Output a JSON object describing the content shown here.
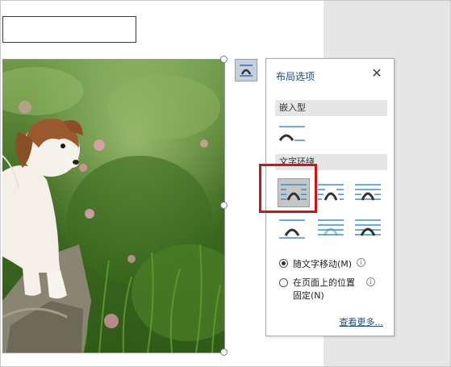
{
  "pane": {
    "title": "布局选项",
    "close_label": "✕",
    "inline_section": "嵌入型",
    "wrap_section": "文字环绕",
    "options": [
      {
        "name": "inline-with-text",
        "icon": "inline-with-text-icon"
      },
      {
        "name": "square",
        "icon": "wrap-square-icon",
        "selected": true
      },
      {
        "name": "tight",
        "icon": "wrap-tight-icon"
      },
      {
        "name": "through",
        "icon": "wrap-through-icon"
      },
      {
        "name": "top-and-bottom",
        "icon": "wrap-top-bottom-icon"
      },
      {
        "name": "behind-text",
        "icon": "behind-text-icon"
      },
      {
        "name": "in-front-of-text",
        "icon": "in-front-of-text-icon"
      }
    ],
    "move_with_text_label": "随文字移动(M)",
    "fix_position_label_line1": "在页面上的位置",
    "fix_position_label_line2": "固定(N)",
    "see_more_label": "查看更多...",
    "selected_radio": "move_with_text"
  },
  "colors": {
    "accent_title": "#1f4e79",
    "highlight_box": "#d11414",
    "launcher_bg": "#c5d0db"
  },
  "icons": {
    "layout_options_button": "layout-options-icon",
    "info": "info-icon"
  }
}
